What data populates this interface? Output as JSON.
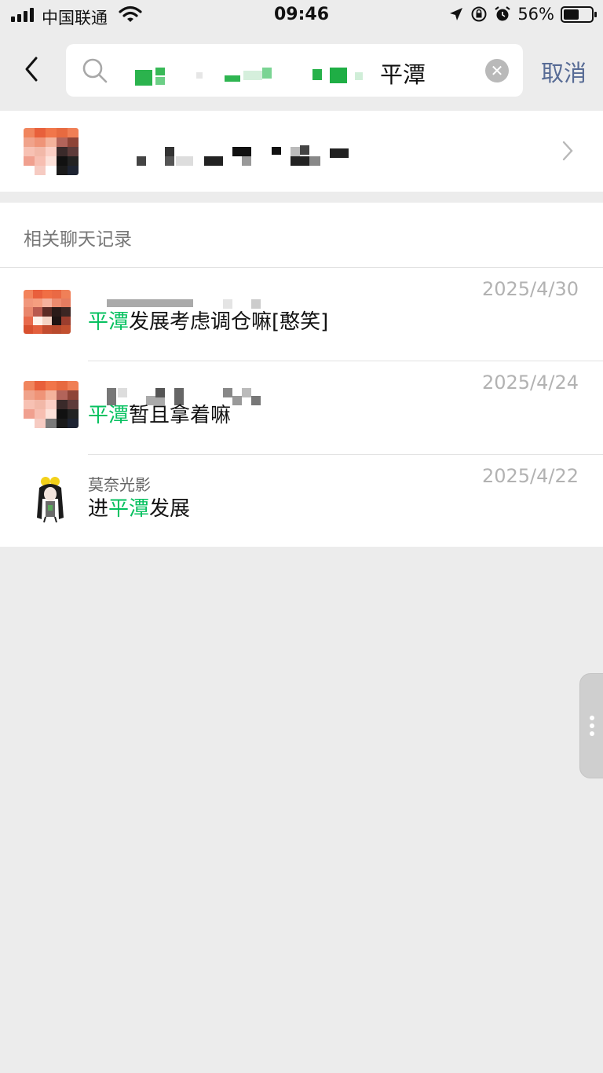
{
  "status_bar": {
    "carrier": "中国联通",
    "time": "09:46",
    "battery_percent": "56%",
    "battery_level": 0.56
  },
  "search": {
    "query_visible": "平潭",
    "cancel_label": "取消"
  },
  "section": {
    "title": "相关聊天记录"
  },
  "chats": [
    {
      "name": "",
      "date": "2025/4/30",
      "highlight": "平潭",
      "rest": "发展考虑调仓嘛[憨笑]"
    },
    {
      "name": "",
      "date": "2025/4/24",
      "highlight": "平潭",
      "rest": "暂且拿着嘛"
    },
    {
      "name": "莫奈光影",
      "date": "2025/4/22",
      "prefix": "进",
      "highlight": "平潭",
      "rest": "发展"
    }
  ],
  "colors": {
    "highlight_green": "#07c160",
    "link_blue": "#576b95",
    "page_background": "#ececec"
  },
  "icons": [
    "back-arrow-icon",
    "search-icon",
    "clear-icon",
    "chevron-right-icon",
    "more-dots-icon"
  ]
}
